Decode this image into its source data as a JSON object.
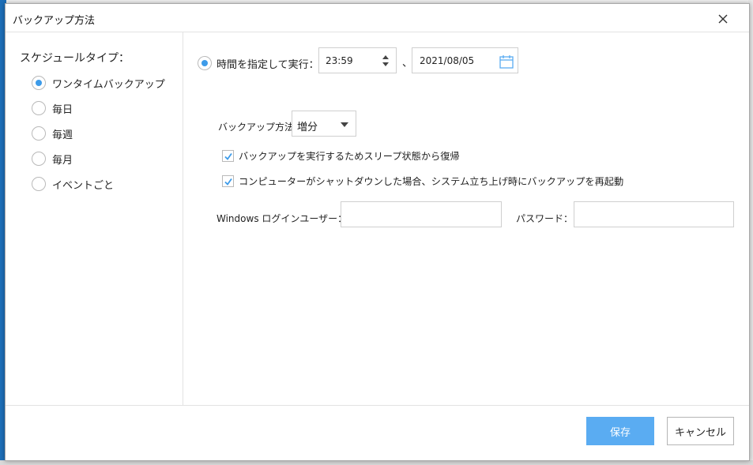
{
  "dialog": {
    "title": "バックアップ方法",
    "close_icon": "close-icon"
  },
  "schedule": {
    "label": "スケジュールタイプ：",
    "options": [
      {
        "label": "ワンタイムバックアップ",
        "checked": true
      },
      {
        "label": "毎日",
        "checked": false
      },
      {
        "label": "毎週",
        "checked": false
      },
      {
        "label": "毎月",
        "checked": false
      },
      {
        "label": "イベントごと",
        "checked": false
      }
    ]
  },
  "timed": {
    "label": "時間を指定して実行：",
    "checked": true,
    "time": "23:59",
    "separator": "、",
    "date": "2021/08/05",
    "calendar_icon": "calendar-icon"
  },
  "method": {
    "label": "バックアップ方法",
    "value": "増分"
  },
  "options": [
    {
      "label": "バックアップを実行するためスリープ状態から復帰",
      "checked": true
    },
    {
      "label": "コンピューターがシャットダウンした場合、システム立ち上げ時にバックアップを再起動",
      "checked": true
    }
  ],
  "login": {
    "user_label": "Windows ログインユーザー：",
    "user_value": "",
    "password_label": "パスワード：",
    "password_value": ""
  },
  "footer": {
    "save_label": "保存",
    "cancel_label": "キャンセル"
  },
  "colors": {
    "accent": "#3d9be9",
    "save_button": "#5aacf2",
    "calendar_icon": "#5aacf2"
  }
}
